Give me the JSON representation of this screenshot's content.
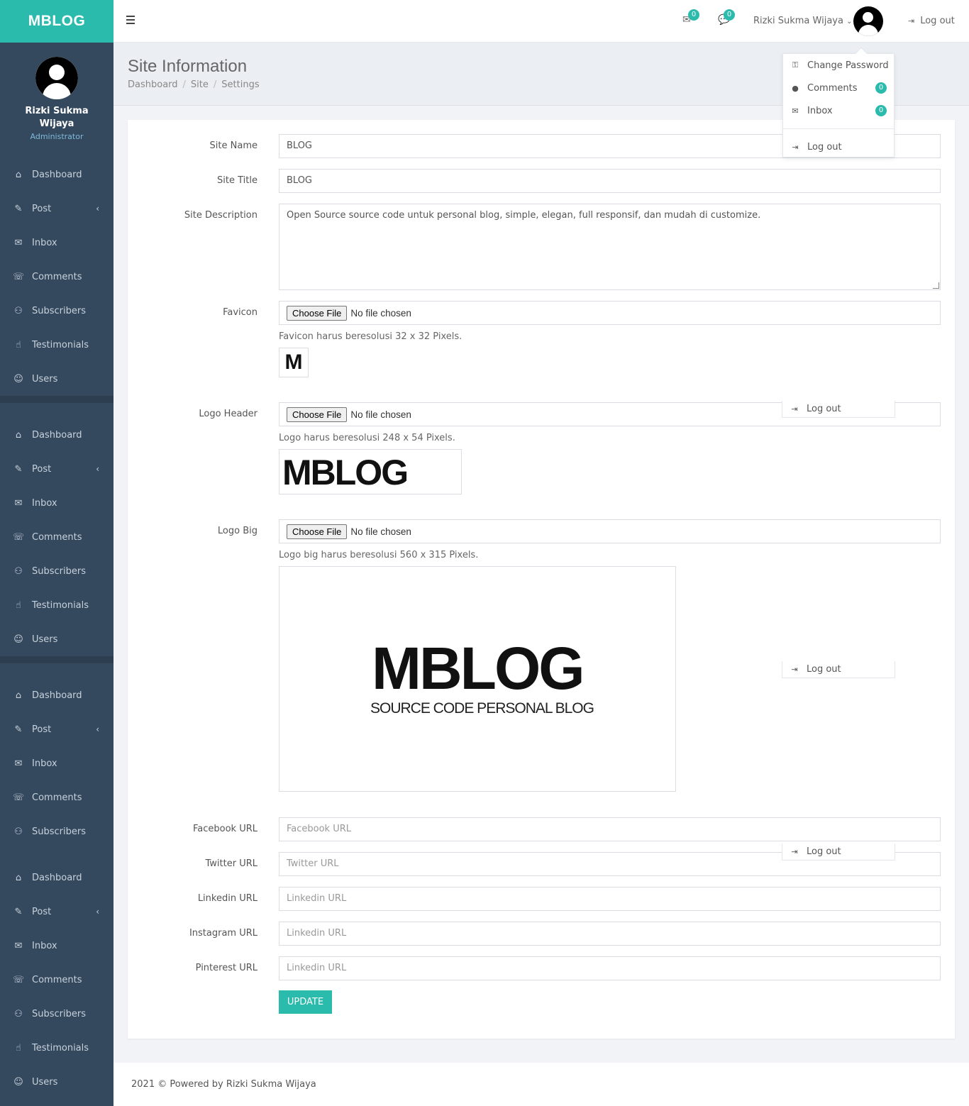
{
  "app": {
    "brand": "MBLOG"
  },
  "user": {
    "name": "Rizki Sukma Wijaya",
    "role": "Administrator"
  },
  "sidebar": {
    "items": [
      {
        "label": "Dashboard",
        "icon": "home-icon"
      },
      {
        "label": "Post",
        "icon": "pin-icon"
      },
      {
        "label": "Inbox",
        "icon": "envelope-icon"
      },
      {
        "label": "Comments",
        "icon": "comments-icon"
      },
      {
        "label": "Subscribers",
        "icon": "users-icon"
      },
      {
        "label": "Testimonials",
        "icon": "thumbs-up-icon"
      },
      {
        "label": "Users",
        "icon": "user-icon"
      }
    ]
  },
  "topbar": {
    "inbox_count": "0",
    "comments_count": "0",
    "user_name": "Rizki Sukma Wijaya",
    "logout_label": "Log out"
  },
  "dropdown": {
    "change_password": "Change Password",
    "comments": "Comments",
    "comments_count": "0",
    "inbox": "Inbox",
    "inbox_count": "0",
    "logout": "Log out"
  },
  "page": {
    "title": "Site Information",
    "breadcrumb": [
      "Dashboard",
      "Site",
      "Settings"
    ]
  },
  "form": {
    "site_name_label": "Site Name",
    "site_name_value": "BLOG",
    "site_title_label": "Site Title",
    "site_title_value": "BLOG",
    "site_description_label": "Site Description",
    "site_description_value": "Open Source source code untuk personal blog, simple, elegan, full responsif, dan mudah di customize.",
    "favicon_label": "Favicon",
    "favicon_help": "Favicon harus beresolusi 32 x 32 Pixels.",
    "favicon_preview_text": "M",
    "logo_header_label": "Logo Header",
    "logo_header_help": "Logo harus beresolusi 248 x 54 Pixels.",
    "logo_header_preview_text": "MBLOG",
    "logo_big_label": "Logo Big",
    "logo_big_help": "Logo big harus beresolusi 560 x 315 Pixels.",
    "logo_big_preview_text": "MBLOG",
    "logo_big_preview_subtext": "SOURCE CODE PERSONAL BLOG",
    "choose_file_label": "Choose File",
    "no_file_text": "No file chosen",
    "facebook_label": "Facebook URL",
    "facebook_placeholder": "Facebook URL",
    "twitter_label": "Twitter URL",
    "twitter_placeholder": "Twitter URL",
    "linkedin_label": "Linkedin URL",
    "linkedin_placeholder": "Linkedin URL",
    "instagram_label": "Instagram URL",
    "instagram_placeholder": "Linkedin URL",
    "pinterest_label": "Pinterest URL",
    "pinterest_placeholder": "Linkedin URL",
    "update_label": "UPDATE"
  },
  "footer": {
    "text": "2021 © Powered by Rizki Sukma Wijaya"
  },
  "colors": {
    "accent": "#2bbbad",
    "sidebar": "#34495e"
  }
}
